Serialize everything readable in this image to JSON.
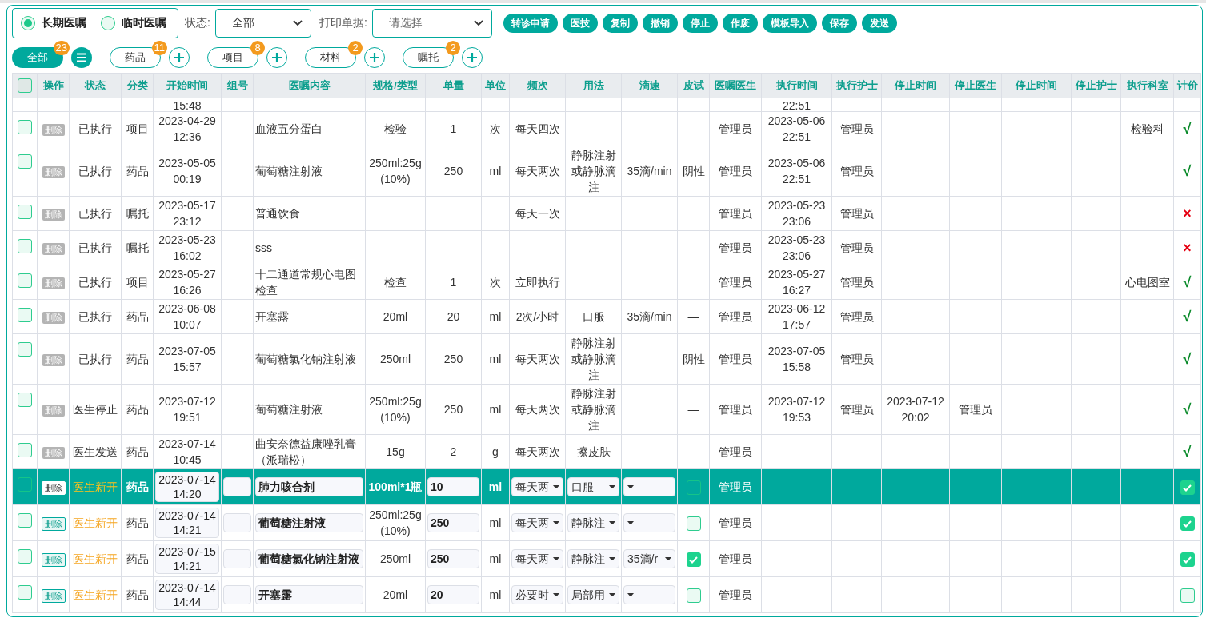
{
  "order_type": [
    {
      "label": "长期医嘱",
      "selected": true
    },
    {
      "label": "临时医嘱",
      "selected": false
    }
  ],
  "status_filter": {
    "label": "状态:",
    "value": "全部"
  },
  "print_filter": {
    "label": "打印单据:",
    "placeholder": "请选择"
  },
  "actions": [
    "转诊申请",
    "医技",
    "复制",
    "撤销",
    "停止",
    "作废",
    "模板导入",
    "保存",
    "发送"
  ],
  "categories": [
    {
      "kind": "all",
      "label": "全部",
      "count": "23",
      "selected": true
    },
    {
      "kind": "category",
      "label": "药品",
      "count": "11",
      "selected": false
    },
    {
      "kind": "category",
      "label": "项目",
      "count": "8",
      "selected": false
    },
    {
      "kind": "category",
      "label": "材料",
      "count": "2",
      "selected": false
    },
    {
      "kind": "category",
      "label": "嘱托",
      "count": "2",
      "selected": false
    }
  ],
  "table": {
    "all_checked": false,
    "columns": [
      "操作",
      "状态",
      "分类",
      "开始时间",
      "组号",
      "医嘱内容",
      "规格/类型",
      "单量",
      "单位",
      "频次",
      "用法",
      "滴速",
      "皮试",
      "医嘱医生",
      "执行时间",
      "执行护士",
      "停止时间",
      "停止医生",
      "停止时间",
      "停止护士",
      "执行科室",
      "计价"
    ],
    "rows": [
      {
        "kind": "partial",
        "selected": false,
        "start_time": "15:48",
        "exec_time": "22:51"
      },
      {
        "kind": "executed",
        "selected": false,
        "checked": false,
        "delete": "删除",
        "status": "已执行",
        "category": "项目",
        "start_time": "2023-04-29 12:36",
        "content": "血液五分蛋白",
        "spec": "检验",
        "dose": "1",
        "unit": "次",
        "frequency": "每天四次",
        "doctor": "管理员",
        "exec_time": "2023-05-06 22:51",
        "exec_nurse": "管理员",
        "exec_dept": "检验科",
        "billing": "√",
        "billed": true
      },
      {
        "kind": "executed",
        "selected": false,
        "checked": false,
        "delete": "删除",
        "status": "已执行",
        "category": "药品",
        "start_time": "2023-05-05 00:19",
        "content": "葡萄糖注射液",
        "spec": "250ml:25g (10%)",
        "dose": "250",
        "unit": "ml",
        "frequency": "每天两次",
        "usage": "静脉注射或静脉滴注",
        "drip_rate": "35滴/min",
        "skin_test": "阴性",
        "doctor": "管理员",
        "exec_time": "2023-05-06 22:51",
        "exec_nurse": "管理员",
        "billing": "√",
        "billed": true
      },
      {
        "kind": "executed",
        "selected": false,
        "checked": false,
        "delete": "删除",
        "status": "已执行",
        "category": "嘱托",
        "start_time": "2023-05-17 23:12",
        "content": "普通饮食",
        "frequency": "每天一次",
        "doctor": "管理员",
        "exec_time": "2023-05-23 23:06",
        "exec_nurse": "管理员",
        "billing": "×",
        "billed": false
      },
      {
        "kind": "executed",
        "selected": false,
        "checked": false,
        "delete": "删除",
        "status": "已执行",
        "category": "嘱托",
        "start_time": "2023-05-23 16:02",
        "content": "sss",
        "doctor": "管理员",
        "exec_time": "2023-05-23 23:06",
        "exec_nurse": "管理员",
        "billing": "×",
        "billed": false
      },
      {
        "kind": "executed",
        "selected": false,
        "checked": false,
        "delete": "删除",
        "status": "已执行",
        "category": "项目",
        "start_time": "2023-05-27 16:26",
        "content": "十二通道常规心电图检查",
        "spec": "检查",
        "dose": "1",
        "unit": "次",
        "frequency": "立即执行",
        "doctor": "管理员",
        "exec_time": "2023-05-27 16:27",
        "exec_nurse": "管理员",
        "exec_dept": "心电图室",
        "billing": "√",
        "billed": true
      },
      {
        "kind": "executed",
        "selected": false,
        "checked": false,
        "delete": "删除",
        "status": "已执行",
        "category": "药品",
        "start_time": "2023-06-08 10:07",
        "content": "开塞露",
        "spec": "20ml",
        "dose": "20",
        "unit": "ml",
        "frequency": "2次/小时",
        "usage": "口服",
        "drip_rate": "35滴/min",
        "skin_test": "—",
        "doctor": "管理员",
        "exec_time": "2023-06-12 17:57",
        "exec_nurse": "管理员",
        "billing": "√",
        "billed": true
      },
      {
        "kind": "executed",
        "selected": false,
        "checked": false,
        "delete": "删除",
        "status": "已执行",
        "category": "药品",
        "start_time": "2023-07-05 15:57",
        "content": "葡萄糖氯化钠注射液",
        "spec": "250ml",
        "dose": "250",
        "unit": "ml",
        "frequency": "每天两次",
        "usage": "静脉注射或静脉滴注",
        "skin_test": "阴性",
        "doctor": "管理员",
        "exec_time": "2023-07-05 15:58",
        "exec_nurse": "管理员",
        "billing": "√",
        "billed": true
      },
      {
        "kind": "executed",
        "selected": false,
        "checked": false,
        "delete": "删除",
        "status": "医生停止",
        "category": "药品",
        "start_time": "2023-07-12 19:51",
        "content": "葡萄糖注射液",
        "spec": "250ml:25g (10%)",
        "dose": "250",
        "unit": "ml",
        "frequency": "每天两次",
        "usage": "静脉注射或静脉滴注",
        "skin_test": "—",
        "doctor": "管理员",
        "exec_time": "2023-07-12 19:53",
        "exec_nurse": "管理员",
        "stop_time": "2023-07-12 20:02",
        "stop_doctor": "管理员",
        "billing": "√",
        "billed": true
      },
      {
        "kind": "executed",
        "selected": false,
        "checked": false,
        "delete": "删除",
        "status": "医生发送",
        "category": "药品",
        "start_time": "2023-07-14 10:45",
        "content": "曲安奈德益康唑乳膏（派瑞松）",
        "spec": "15g",
        "dose": "2",
        "unit": "g",
        "frequency": "每天两次",
        "usage": "擦皮肤",
        "skin_test": "—",
        "doctor": "管理员",
        "billing": "√",
        "billed": true
      },
      {
        "kind": "draft",
        "selected": true,
        "checked": false,
        "delete": "删除",
        "status": "医生新开",
        "category": "药品",
        "start_time": "2023-07-14 14:20",
        "content": "肺力咳合剂",
        "spec": "100ml*1瓶",
        "dose": "10",
        "unit": "ml",
        "frequency": "每天两",
        "usage": "口服",
        "skin_checked": false,
        "doctor": "管理员",
        "billed": true
      },
      {
        "kind": "draft",
        "selected": false,
        "checked": false,
        "delete": "删除",
        "status": "医生新开",
        "category": "药品",
        "start_time": "2023-07-14 14:21",
        "content": "葡萄糖注射液",
        "spec": "250ml:25g (10%)",
        "dose": "250",
        "unit": "ml",
        "frequency": "每天两",
        "usage": "静脉注",
        "skin_checked": false,
        "doctor": "管理员",
        "billed": true
      },
      {
        "kind": "draft",
        "selected": false,
        "checked": false,
        "delete": "删除",
        "status": "医生新开",
        "category": "药品",
        "start_time": "2023-07-15 14:21",
        "content": "葡萄糖氯化钠注射液",
        "spec": "250ml",
        "dose": "250",
        "unit": "ml",
        "frequency": "每天两",
        "usage": "静脉注",
        "drip_rate": "35滴/r",
        "skin_checked": true,
        "doctor": "管理员",
        "billed": true
      },
      {
        "kind": "draft",
        "selected": false,
        "checked": false,
        "delete": "删除",
        "status": "医生新开",
        "category": "药品",
        "start_time": "2023-07-14 14:44",
        "content": "开塞露",
        "spec": "20ml",
        "dose": "20",
        "unit": "ml",
        "frequency": "必要时",
        "usage": "局部用",
        "skin_checked": false,
        "doctor": "管理员",
        "billed": false
      }
    ]
  }
}
